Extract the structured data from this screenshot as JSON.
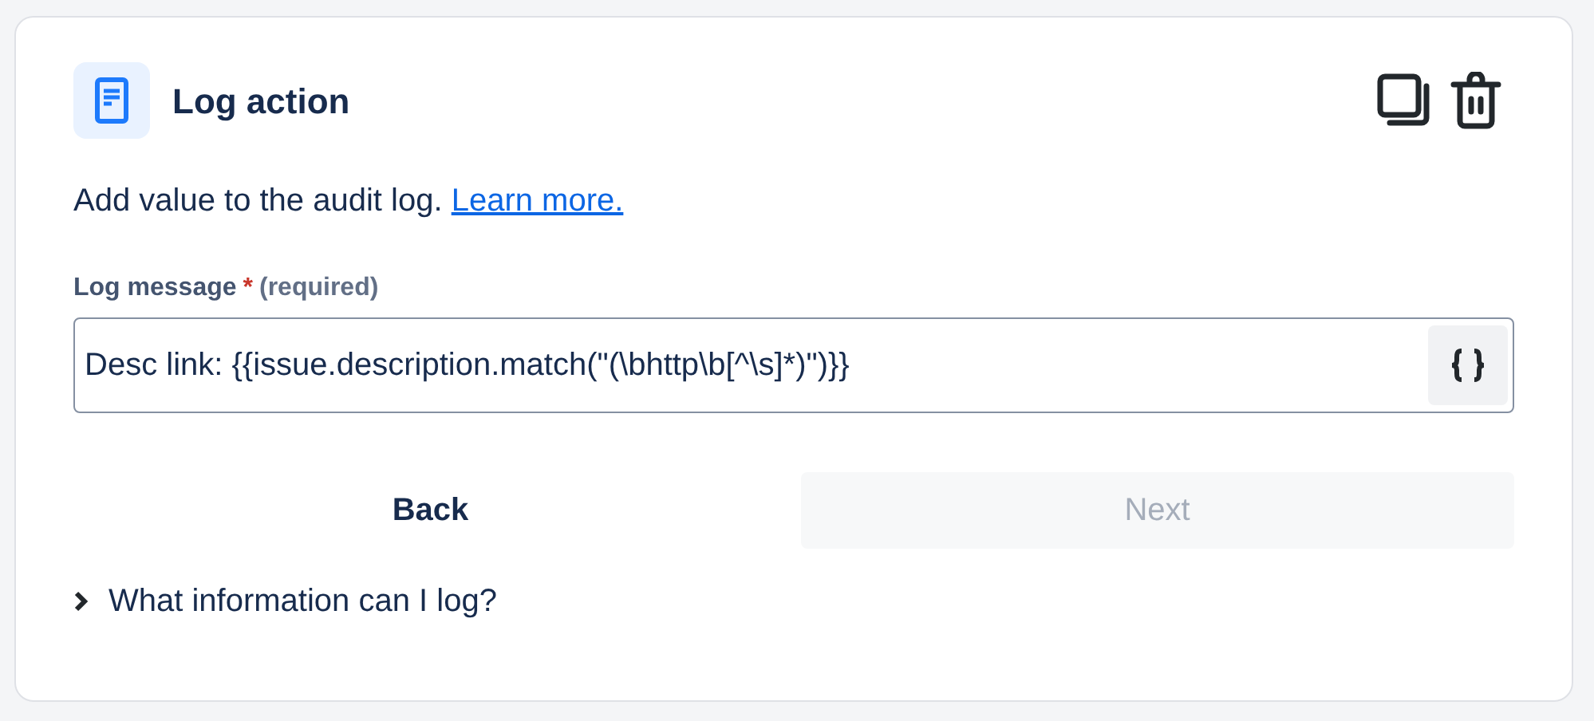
{
  "header": {
    "title": "Log action"
  },
  "description": {
    "text": "Add value to the audit log.",
    "link": "Learn more."
  },
  "field": {
    "label": "Log message",
    "required_mark": "*",
    "hint": "(required)",
    "value": "Desc link: {{issue.description.match(\"(\\bhttp\\b[^\\s]*)\")}}"
  },
  "buttons": [
    {
      "label": "Back",
      "disabled": false
    },
    {
      "label": "Next",
      "disabled": true
    }
  ],
  "expander": {
    "label": "What information can I log?",
    "expanded": false
  }
}
